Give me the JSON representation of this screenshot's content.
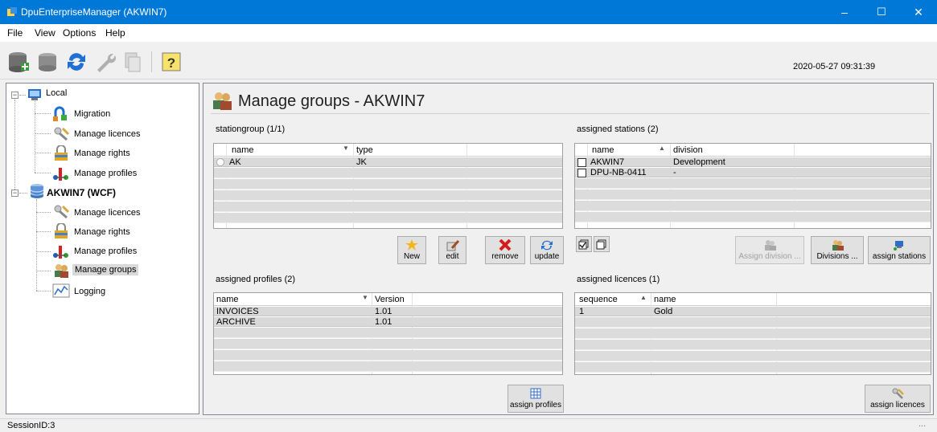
{
  "window": {
    "title": "DpuEnterpriseManager (AKWIN7)",
    "minimize": "–",
    "maximize": "☐",
    "close": "✕"
  },
  "menu": [
    "File",
    "View",
    "Options",
    "Help"
  ],
  "toolbar": {
    "timestamp": "2020-05-27 09:31:39"
  },
  "tree": {
    "local": "Local",
    "local_items": [
      "Migration",
      "Manage licences",
      "Manage rights",
      "Manage profiles"
    ],
    "server": "AKWIN7 (WCF)",
    "server_items": [
      "Manage licences",
      "Manage rights",
      "Manage profiles",
      "Manage groups",
      "Logging"
    ]
  },
  "main": {
    "title": "Manage groups - AKWIN7",
    "stationgroup": {
      "label": "stationgroup (1/1)",
      "columns": [
        "name",
        "type"
      ],
      "rows": [
        {
          "name": "AK",
          "type": "JK"
        }
      ]
    },
    "assigned_stations": {
      "label": "assigned stations (2)",
      "columns": [
        "name",
        "division"
      ],
      "rows": [
        {
          "name": "AKWIN7",
          "division": "Development"
        },
        {
          "name": "DPU-NB-0411",
          "division": "-"
        }
      ]
    },
    "group_buttons": {
      "new": "New",
      "edit": "edit",
      "remove": "remove",
      "update": "update"
    },
    "station_buttons": {
      "assign_division": "Assign division ...",
      "divisions": "Divisions ...",
      "assign_stations": "assign stations"
    },
    "assigned_profiles": {
      "label": "assigned profiles (2)",
      "columns": [
        "name",
        "Version"
      ],
      "rows": [
        {
          "name": "INVOICES",
          "version": "1.01"
        },
        {
          "name": "ARCHIVE",
          "version": "1.01"
        }
      ]
    },
    "assigned_licences": {
      "label": "assigned licences (1)",
      "columns": [
        "sequence",
        "name"
      ],
      "rows": [
        {
          "sequence": "1",
          "name": "Gold"
        }
      ]
    },
    "assign_profiles": "assign profiles",
    "assign_licences": "assign licences"
  },
  "status": {
    "session": "SessionID:3",
    "right": "..."
  },
  "colors": {
    "titlebar": "#0078d7",
    "grid_row": "#d9d9d9",
    "panel": "#f0f0f0"
  },
  "icons": [
    "database-add-icon",
    "database-icon",
    "refresh-icon",
    "wrench-icon",
    "copy-icon",
    "help-icon",
    "users-icon",
    "key-icon",
    "lock-icon",
    "profile-icon",
    "chart-icon",
    "migration-icon"
  ]
}
